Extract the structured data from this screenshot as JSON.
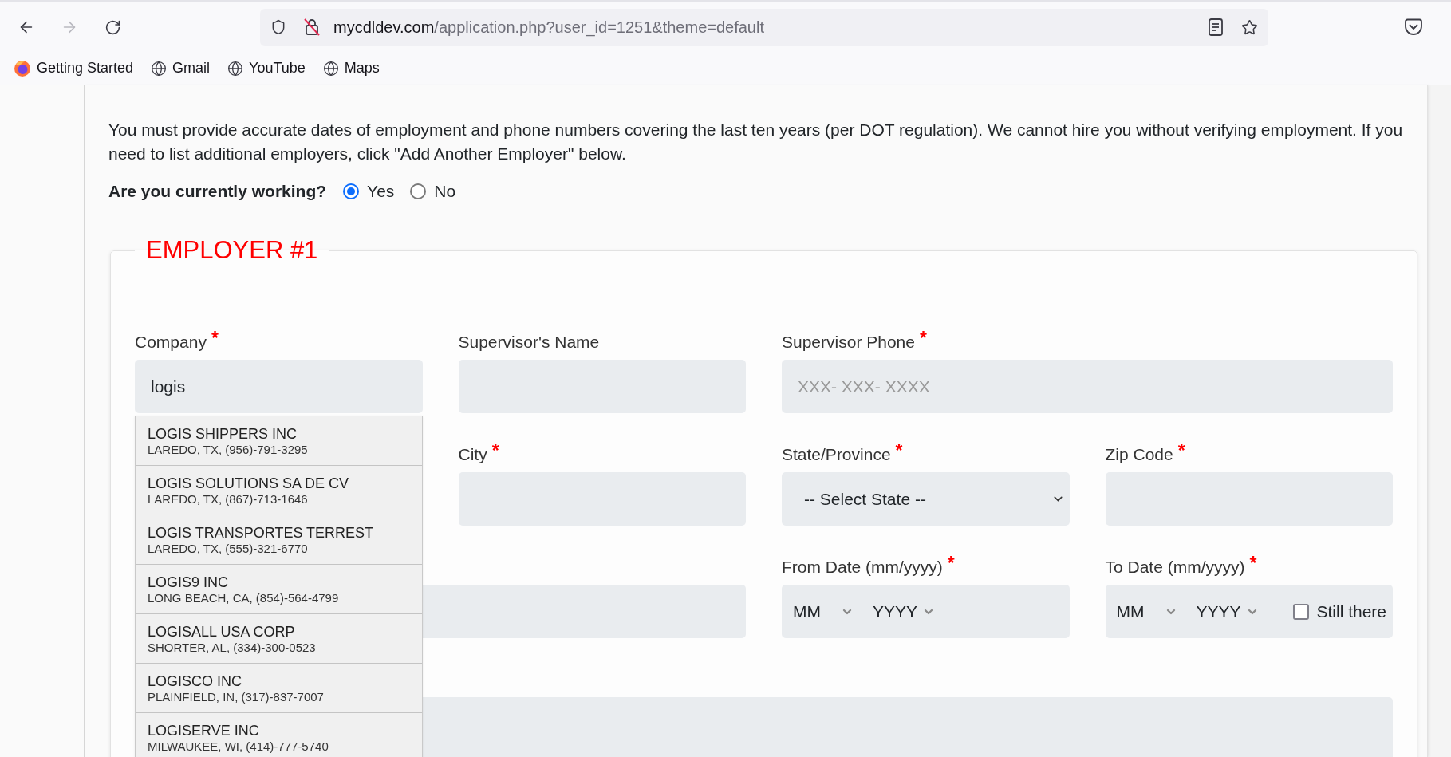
{
  "browser": {
    "nav": [
      {
        "kind": "back",
        "disabled": false
      },
      {
        "kind": "forward",
        "disabled": true
      },
      {
        "kind": "reload",
        "disabled": false
      }
    ],
    "url": {
      "host": "mycdldev.com",
      "path": "/application.php?user_id=1251&theme=default"
    },
    "bookmarks": [
      {
        "label": "Getting Started",
        "kind": "browser_page"
      },
      {
        "label": "Gmail",
        "kind": "site"
      },
      {
        "label": "YouTube",
        "kind": "site"
      },
      {
        "label": "Maps",
        "kind": "site"
      }
    ]
  },
  "intro": "You must provide accurate dates of employment and phone numbers covering the last ten years (per DOT regulation). We cannot hire you without verifying employment. If you need to list additional employers, click \"Add Another Employer\" below.",
  "currently_working": {
    "question": "Are you currently working?",
    "options": [
      {
        "label": "Yes",
        "selected": true
      },
      {
        "label": "No",
        "selected": false
      }
    ]
  },
  "employer": {
    "title": "EMPLOYER #1",
    "company": {
      "label": "Company",
      "required_mark": "*",
      "value": "logis"
    },
    "supervisor_name": {
      "label": "Supervisor's Name"
    },
    "supervisor_phone": {
      "label": "Supervisor Phone",
      "required_mark": "*",
      "placeholder": "XXX- XXX- XXXX"
    },
    "city": {
      "label": "City",
      "required_mark": "*"
    },
    "state": {
      "label": "State/Province",
      "required_mark": "*",
      "value": "-- Select State --"
    },
    "zip_code": {
      "label": "Zip Code",
      "required_mark": "*"
    },
    "from_date": {
      "label": "From Date (mm/yyyy)",
      "required_mark": "*",
      "month": "MM",
      "year": "YYYY"
    },
    "to_date": {
      "label": "To Date (mm/yyyy)",
      "required_mark": "*",
      "month": "MM",
      "year": "YYYY",
      "still_there": {
        "label": "Still there",
        "checked": false
      }
    },
    "company_suggestions": [
      {
        "name": "LOGIS SHIPPERS INC",
        "details": "LAREDO, TX, (956)-791-3295"
      },
      {
        "name": "LOGIS SOLUTIONS SA DE CV",
        "details": "LAREDO, TX, (867)-713-1646"
      },
      {
        "name": "LOGIS TRANSPORTES TERREST",
        "details": "LAREDO, TX, (555)-321-6770"
      },
      {
        "name": "LOGIS9 INC",
        "details": "LONG BEACH, CA, (854)-564-4799"
      },
      {
        "name": "LOGISALL USA CORP",
        "details": "SHORTER, AL, (334)-300-0523"
      },
      {
        "name": "LOGISCO INC",
        "details": "PLAINFIELD, IN, (317)-837-7007"
      },
      {
        "name": "LOGISERVE INC",
        "details": "MILWAUKEE, WI, (414)-777-5740"
      }
    ]
  }
}
